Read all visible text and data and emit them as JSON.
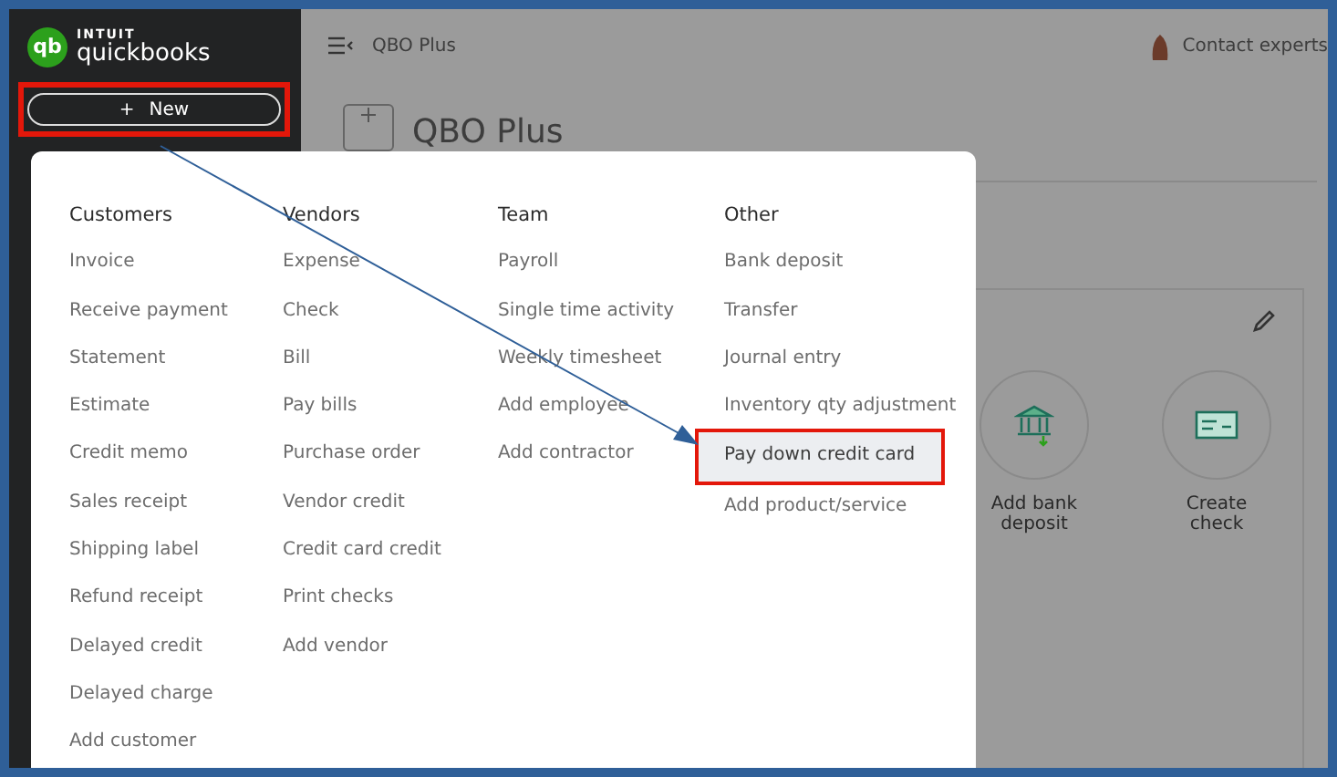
{
  "sidebar": {
    "logo_mark": "qb",
    "logo_brand": "INTUIT",
    "logo_product": "quickbooks",
    "new_button": {
      "icon": "+",
      "label": "New",
      "highlighted": true
    }
  },
  "topbar": {
    "company": "QBO Plus",
    "contact": "Contact experts"
  },
  "page": {
    "title": "QBO Plus",
    "actions": [
      {
        "label": "Add bank deposit",
        "kind": "bank"
      },
      {
        "label": "Create check",
        "kind": "check"
      }
    ]
  },
  "new_menu": {
    "columns": [
      {
        "heading": "Customers",
        "items": [
          {
            "label": "Invoice",
            "highlighted": false
          },
          {
            "label": "Receive payment",
            "highlighted": false
          },
          {
            "label": "Statement",
            "highlighted": false
          },
          {
            "label": "Estimate",
            "highlighted": false
          },
          {
            "label": "Credit memo",
            "highlighted": false
          },
          {
            "label": "Sales receipt",
            "highlighted": false
          },
          {
            "label": "Shipping label",
            "highlighted": false
          },
          {
            "label": "Refund receipt",
            "highlighted": false
          },
          {
            "label": "Delayed credit",
            "highlighted": false
          },
          {
            "label": "Delayed charge",
            "highlighted": false
          },
          {
            "label": "Add customer",
            "highlighted": false
          }
        ]
      },
      {
        "heading": "Vendors",
        "items": [
          {
            "label": "Expense",
            "highlighted": false
          },
          {
            "label": "Check",
            "highlighted": false
          },
          {
            "label": "Bill",
            "highlighted": false
          },
          {
            "label": "Pay bills",
            "highlighted": false
          },
          {
            "label": "Purchase order",
            "highlighted": false
          },
          {
            "label": "Vendor credit",
            "highlighted": false
          },
          {
            "label": "Credit card credit",
            "highlighted": false
          },
          {
            "label": "Print checks",
            "highlighted": false
          },
          {
            "label": "Add vendor",
            "highlighted": false
          }
        ]
      },
      {
        "heading": "Team",
        "items": [
          {
            "label": "Payroll",
            "highlighted": false
          },
          {
            "label": "Single time activity",
            "highlighted": false
          },
          {
            "label": "Weekly timesheet",
            "highlighted": false
          },
          {
            "label": "Add employee",
            "highlighted": false
          },
          {
            "label": "Add contractor",
            "highlighted": false
          }
        ]
      },
      {
        "heading": "Other",
        "items": [
          {
            "label": "Bank deposit",
            "highlighted": false
          },
          {
            "label": "Transfer",
            "highlighted": false
          },
          {
            "label": "Journal entry",
            "highlighted": false
          },
          {
            "label": "Inventory qty adjustment",
            "highlighted": false
          },
          {
            "label": "Pay down credit card",
            "highlighted": true
          },
          {
            "label": "Add product/service",
            "highlighted": false
          }
        ]
      }
    ]
  }
}
